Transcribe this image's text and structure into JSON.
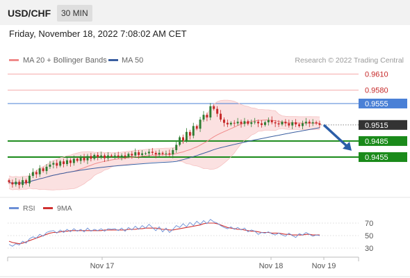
{
  "header": {
    "symbol": "USD/CHF",
    "interval": "30 MIN",
    "timestamp": "Friday, November 18, 2022 7:08:02 AM CET"
  },
  "colors": {
    "bollinger_line": "#f08a8a",
    "bollinger_fill": "#fbe1e1",
    "ma50": "#3a5ea0",
    "up_candle": "#2e7d32",
    "down_candle": "#c62828",
    "resistance": "#f5a8a8",
    "pivot": "#4a80d6",
    "support": "#1a8a1a",
    "last_price_bg": "#333333",
    "arrow": "#2b5ea8",
    "rsi_line": "#6b8fd6",
    "rsi_ma": "#d03030"
  },
  "chart_data": [
    {
      "type": "candlestick",
      "legend": [
        {
          "label": "MA 20 + Bollinger Bands",
          "color": "#f08a8a"
        },
        {
          "label": "MA 50",
          "color": "#3a5ea0"
        }
      ],
      "watermark": "Research © 2022 Trading Central",
      "ylim": [
        9.385,
        0.9625
      ],
      "x_ticks": [
        "Nov 17",
        "Nov 18",
        "Nov 19"
      ],
      "levels": [
        {
          "value": 0.961,
          "label": "0.9610",
          "kind": "resistance"
        },
        {
          "value": 0.958,
          "label": "0.9580",
          "kind": "resistance"
        },
        {
          "value": 0.9555,
          "label": "0.9555",
          "kind": "pivot"
        },
        {
          "value": 0.9515,
          "label": "0.9515",
          "kind": "last"
        },
        {
          "value": 0.9485,
          "label": "0.9485",
          "kind": "support"
        },
        {
          "value": 0.9455,
          "label": "0.9455",
          "kind": "support"
        }
      ],
      "closes": [
        0.9408,
        0.9404,
        0.9409,
        0.9403,
        0.9412,
        0.9406,
        0.942,
        0.9427,
        0.9423,
        0.9434,
        0.9429,
        0.9437,
        0.9441,
        0.9444,
        0.9439,
        0.9447,
        0.9442,
        0.9449,
        0.9444,
        0.9452,
        0.9448,
        0.9454,
        0.9449,
        0.9457,
        0.9452,
        0.9459,
        0.9455,
        0.9458,
        0.9453,
        0.9458,
        0.9457,
        0.9458,
        0.9456,
        0.9458,
        0.9456,
        0.9461,
        0.9458,
        0.9464,
        0.9459,
        0.9462,
        0.9462,
        0.9465,
        0.9463,
        0.946,
        0.9463,
        0.9461,
        0.9462,
        0.946,
        0.9468,
        0.9478,
        0.9492,
        0.9486,
        0.9502,
        0.9495,
        0.9513,
        0.9508,
        0.9525,
        0.9534,
        0.9529,
        0.955,
        0.9545,
        0.9536,
        0.9525,
        0.9519,
        0.9516,
        0.9519,
        0.9518,
        0.9521,
        0.9517,
        0.9522,
        0.9517,
        0.952,
        0.9521,
        0.9518,
        0.9515,
        0.952,
        0.9524,
        0.952,
        0.9518,
        0.9516,
        0.9521,
        0.9518,
        0.9514,
        0.952,
        0.9516,
        0.9513,
        0.9518,
        0.9521,
        0.9518,
        0.952,
        0.9518,
        0.9515
      ],
      "projection": {
        "from": 0.9515,
        "to": 0.9485
      }
    },
    {
      "type": "line",
      "legend": [
        {
          "label": "RSI",
          "color": "#6b8fd6"
        },
        {
          "label": "9MA",
          "color": "#d03030"
        }
      ],
      "y_ticks": [
        70,
        50,
        30
      ],
      "ylim": [
        20,
        80
      ],
      "rsi": [
        36,
        33,
        37,
        35,
        41,
        38,
        45,
        48,
        46,
        52,
        49,
        55,
        57,
        58,
        54,
        59,
        55,
        60,
        56,
        61,
        57,
        60,
        56,
        62,
        57,
        60,
        58,
        61,
        57,
        61,
        60,
        61,
        58,
        62,
        57,
        63,
        59,
        65,
        60,
        66,
        62,
        68,
        63,
        58,
        64,
        56,
        62,
        55,
        60,
        66,
        63,
        69,
        64,
        71,
        66,
        73,
        68,
        74,
        69,
        76,
        72,
        70,
        66,
        63,
        61,
        64,
        60,
        63,
        59,
        62,
        56,
        59,
        57,
        52,
        55,
        54,
        56,
        53,
        51,
        54,
        51,
        49,
        54,
        50,
        47,
        53,
        51,
        55,
        52,
        49,
        51,
        50
      ],
      "ma": [
        41,
        39,
        38,
        37,
        38,
        40,
        42,
        44,
        46,
        48,
        50,
        52,
        54,
        55,
        55,
        56,
        57,
        57,
        58,
        58,
        58,
        58,
        58,
        58,
        58,
        58,
        58,
        58,
        59,
        59,
        59,
        59,
        59,
        59,
        59,
        60,
        60,
        60,
        61,
        61,
        62,
        62,
        62,
        62,
        61,
        60,
        60,
        59,
        59,
        60,
        61,
        62,
        63,
        64,
        65,
        66,
        67,
        69,
        70,
        70,
        70,
        69,
        67,
        65,
        63,
        62,
        61,
        60,
        60,
        59,
        58,
        57,
        57,
        56,
        55,
        55,
        55,
        54,
        54,
        54,
        53,
        52,
        52,
        51,
        51,
        51,
        51,
        52,
        52,
        51,
        51,
        51
      ]
    }
  ]
}
